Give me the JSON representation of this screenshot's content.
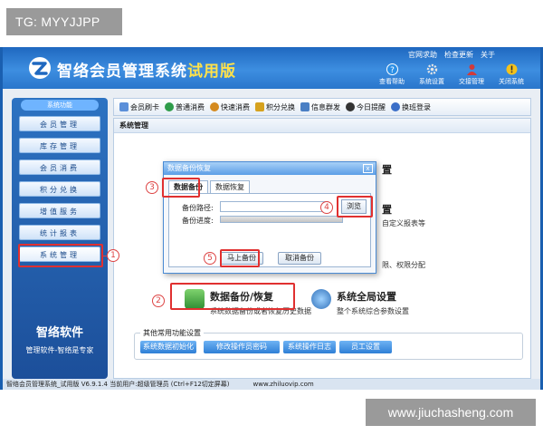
{
  "watermarks": {
    "top": "TG: MYYJJPP",
    "bottom": "www.jiuchasheng.com"
  },
  "app": {
    "title_main": "智络会员管理系统",
    "title_edition": "试用版",
    "system_menu": [
      "官网求助",
      "检查更新",
      "关于"
    ],
    "top_icons": [
      {
        "icon": "question-icon",
        "label": "查看帮助"
      },
      {
        "icon": "gear-icon",
        "label": "系统设置"
      },
      {
        "icon": "user-icon",
        "label": "交接管理"
      },
      {
        "icon": "warning-icon",
        "label": "关闭系统"
      }
    ]
  },
  "sidebar": {
    "header": "系统功能",
    "items": [
      "会员管理",
      "库存管理",
      "会员消费",
      "积分兑换",
      "增值服务",
      "统计报表",
      "系统管理"
    ],
    "active_item": "系统管理",
    "brand_name": "智络软件",
    "brand_slogan": "管理软件-智络是专家"
  },
  "toolbar": {
    "items": [
      {
        "icon": "card-icon",
        "label": "会员刷卡",
        "color": "#5b8fd9"
      },
      {
        "icon": "globe-icon",
        "label": "普通消费",
        "color": "#2e9c4a"
      },
      {
        "icon": "person-icon",
        "label": "快速消费",
        "color": "#d48a1f"
      },
      {
        "icon": "gift-icon",
        "label": "积分兑换",
        "color": "#d6a21e"
      },
      {
        "icon": "mail-icon",
        "label": "信息群发",
        "color": "#4a7fc4"
      },
      {
        "icon": "clock-icon",
        "label": "今日提醒",
        "color": "#333333"
      },
      {
        "icon": "refresh-icon",
        "label": "换班登录",
        "color": "#3b6fc8"
      }
    ]
  },
  "content": {
    "breadcrumb": "系统管理",
    "behind_headings": [
      "置",
      "置"
    ],
    "behind_descs": [
      "自定义报表等",
      "限、权限分配"
    ],
    "features": [
      {
        "icon": "backup-icon",
        "title": "数据备份/恢复",
        "desc": "系统数据备份或者恢复历史数据",
        "color": "#3a9a3c"
      },
      {
        "icon": "globe-settings-icon",
        "title": "系统全局设置",
        "desc": "整个系统综合参数设置",
        "color": "#2f6fb8"
      }
    ],
    "common_title": "其他常用功能设置",
    "common_buttons": [
      "系统数据初始化",
      "修改操作员密码",
      "系统操作日志",
      "员工设置"
    ]
  },
  "status_bar": {
    "text_left": "智络会员管理系统_试用版 V6.9.1.4 当前用户:超级管理员 (Ctrl+F12切定屏幕)",
    "text_url": "www.zhiluovip.com"
  },
  "dialog": {
    "title": "数据备份恢复",
    "tabs": [
      "数据备份",
      "数据恢复"
    ],
    "active_tab": "数据备份",
    "path_label": "备份路径:",
    "path_value": "",
    "browse_label": "浏览",
    "progress_label": "备份进度:",
    "progress": 0.0,
    "confirm_label": "马上备份",
    "cancel_label": "取消备份"
  },
  "annotations": [
    "1",
    "2",
    "3",
    "4",
    "5"
  ],
  "colors": {
    "accent": "#1f68c0",
    "annotation": "#e03030",
    "edition": "#ffe24a"
  }
}
